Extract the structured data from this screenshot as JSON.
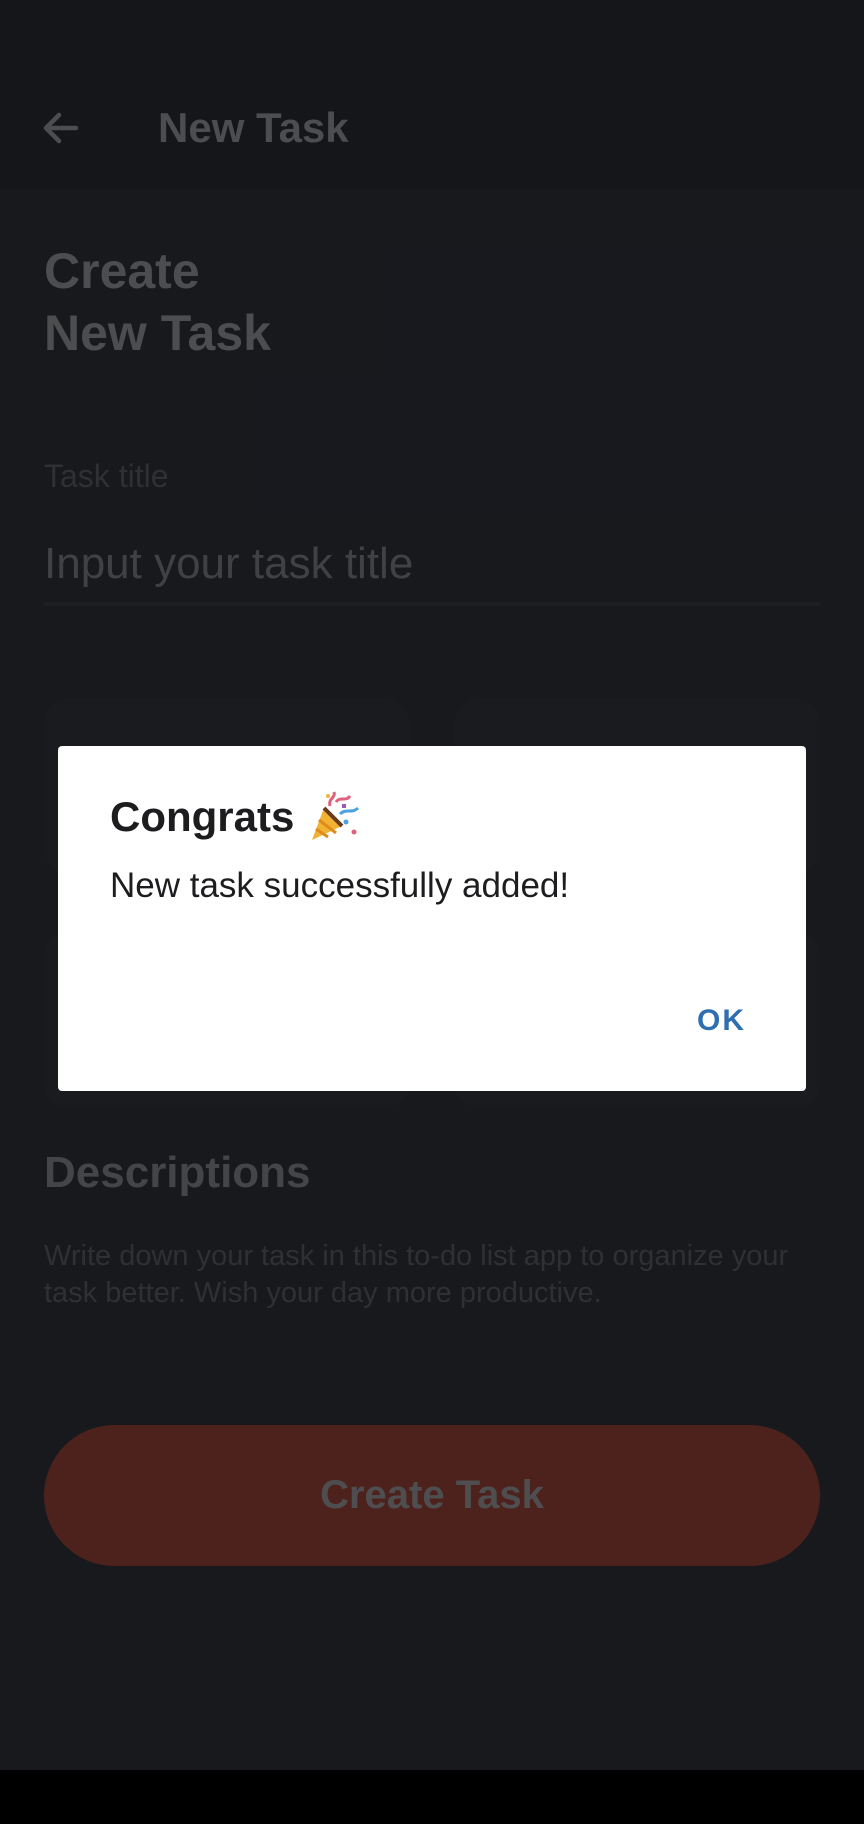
{
  "app_bar": {
    "title": "New Task"
  },
  "page": {
    "title_line1": "Create",
    "title_line2": "New Task"
  },
  "task_title_field": {
    "label": "Task title",
    "placeholder": "Input your task title",
    "value": ""
  },
  "descriptions": {
    "heading": "Descriptions",
    "text": "Write down your task in this to-do list app to organize your task better. Wish your day more productive."
  },
  "create_button": {
    "label": "Create Task"
  },
  "dialog": {
    "title": "Congrats",
    "title_icon": "party-popper-icon",
    "message": "New task successfully added!",
    "ok_label": "OK"
  },
  "colors": {
    "accent": "#2f6fb0",
    "primary_button": "#8e3f33",
    "background": "#2b2e36"
  }
}
